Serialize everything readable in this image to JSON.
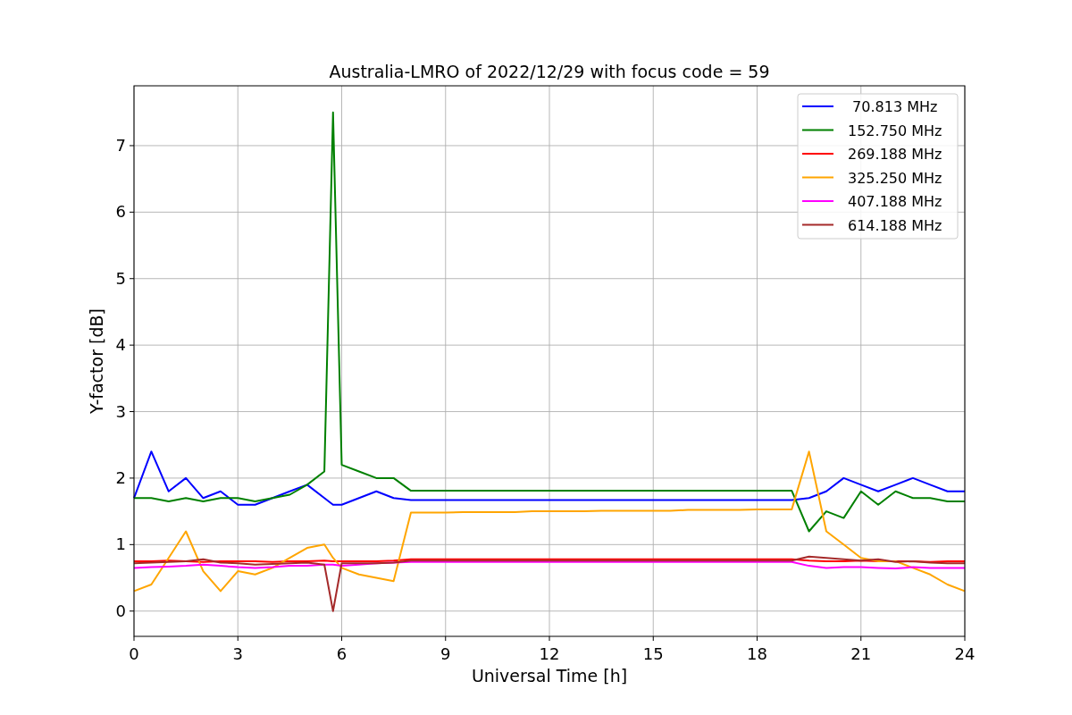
{
  "chart_data": {
    "type": "line",
    "title": "Australia-LMRO of 2022/12/29 with focus code = 59",
    "xlabel": "Universal Time [h]",
    "ylabel": "Y-factor [dB]",
    "x": [
      0,
      0.5,
      1,
      1.5,
      2,
      2.5,
      3,
      3.5,
      4,
      4.5,
      5,
      5.5,
      5.75,
      6,
      6.5,
      7,
      7.5,
      8,
      8.5,
      9,
      9.5,
      10,
      10.5,
      11,
      11.5,
      12,
      12.5,
      13,
      13.5,
      14,
      14.5,
      15,
      15.5,
      16,
      16.5,
      17,
      17.5,
      18,
      18.5,
      19,
      19.5,
      20,
      20.5,
      21,
      21.5,
      22,
      22.5,
      23,
      23.5,
      24
    ],
    "series": [
      {
        "name": " 70.813 MHz",
        "color": "#0000ff",
        "values": [
          1.7,
          2.4,
          1.8,
          2.0,
          1.7,
          1.8,
          1.6,
          1.6,
          1.7,
          1.8,
          1.9,
          1.7,
          1.6,
          1.6,
          1.7,
          1.8,
          1.7,
          1.67,
          1.67,
          1.67,
          1.67,
          1.67,
          1.67,
          1.67,
          1.67,
          1.67,
          1.67,
          1.67,
          1.67,
          1.67,
          1.67,
          1.67,
          1.67,
          1.67,
          1.67,
          1.67,
          1.67,
          1.67,
          1.67,
          1.67,
          1.7,
          1.8,
          2.0,
          1.9,
          1.8,
          1.9,
          2.0,
          1.9,
          1.8,
          1.8
        ]
      },
      {
        "name": "152.750 MHz",
        "color": "#008000",
        "values": [
          1.7,
          1.7,
          1.65,
          1.7,
          1.65,
          1.7,
          1.7,
          1.65,
          1.7,
          1.75,
          1.9,
          2.1,
          7.5,
          2.2,
          2.1,
          2.0,
          2.0,
          1.81,
          1.81,
          1.81,
          1.81,
          1.81,
          1.81,
          1.81,
          1.81,
          1.81,
          1.81,
          1.81,
          1.81,
          1.81,
          1.81,
          1.81,
          1.81,
          1.81,
          1.81,
          1.81,
          1.81,
          1.81,
          1.81,
          1.81,
          1.2,
          1.5,
          1.4,
          1.8,
          1.6,
          1.8,
          1.7,
          1.7,
          1.65,
          1.65
        ]
      },
      {
        "name": "269.188 MHz",
        "color": "#ff0000",
        "values": [
          0.75,
          0.75,
          0.76,
          0.75,
          0.74,
          0.75,
          0.75,
          0.75,
          0.74,
          0.75,
          0.75,
          0.76,
          0.75,
          0.75,
          0.75,
          0.75,
          0.76,
          0.78,
          0.78,
          0.78,
          0.78,
          0.78,
          0.78,
          0.78,
          0.78,
          0.78,
          0.78,
          0.78,
          0.78,
          0.78,
          0.78,
          0.78,
          0.78,
          0.78,
          0.78,
          0.78,
          0.78,
          0.78,
          0.78,
          0.78,
          0.76,
          0.75,
          0.75,
          0.76,
          0.75,
          0.75,
          0.75,
          0.74,
          0.75,
          0.75
        ]
      },
      {
        "name": "325.250 MHz",
        "color": "#ffa500",
        "values": [
          0.3,
          0.4,
          0.8,
          1.2,
          0.6,
          0.3,
          0.6,
          0.55,
          0.65,
          0.8,
          0.95,
          1.0,
          0.8,
          0.65,
          0.55,
          0.5,
          0.45,
          1.48,
          1.48,
          1.48,
          1.49,
          1.49,
          1.49,
          1.49,
          1.5,
          1.5,
          1.5,
          1.5,
          1.51,
          1.51,
          1.51,
          1.51,
          1.51,
          1.52,
          1.52,
          1.52,
          1.52,
          1.53,
          1.53,
          1.53,
          2.4,
          1.2,
          1.0,
          0.8,
          0.75,
          0.75,
          0.65,
          0.55,
          0.4,
          0.3
        ]
      },
      {
        "name": "407.188 MHz",
        "color": "#ff00ff",
        "values": [
          0.65,
          0.66,
          0.67,
          0.68,
          0.7,
          0.68,
          0.66,
          0.65,
          0.66,
          0.68,
          0.68,
          0.7,
          0.7,
          0.68,
          0.7,
          0.72,
          0.73,
          0.74,
          0.74,
          0.74,
          0.74,
          0.74,
          0.74,
          0.74,
          0.74,
          0.74,
          0.74,
          0.74,
          0.74,
          0.74,
          0.74,
          0.74,
          0.74,
          0.74,
          0.74,
          0.74,
          0.74,
          0.74,
          0.74,
          0.74,
          0.68,
          0.65,
          0.66,
          0.66,
          0.65,
          0.64,
          0.66,
          0.65,
          0.65,
          0.65
        ]
      },
      {
        "name": "614.188 MHz",
        "color": "#a52a2a",
        "values": [
          0.72,
          0.73,
          0.74,
          0.75,
          0.78,
          0.73,
          0.72,
          0.7,
          0.71,
          0.72,
          0.73,
          0.7,
          0.0,
          0.72,
          0.72,
          0.72,
          0.73,
          0.76,
          0.76,
          0.76,
          0.76,
          0.76,
          0.76,
          0.76,
          0.76,
          0.76,
          0.76,
          0.76,
          0.76,
          0.76,
          0.76,
          0.76,
          0.76,
          0.76,
          0.76,
          0.76,
          0.76,
          0.76,
          0.76,
          0.76,
          0.82,
          0.8,
          0.78,
          0.76,
          0.78,
          0.74,
          0.75,
          0.73,
          0.72,
          0.72
        ]
      }
    ],
    "grid": true,
    "legend": true,
    "xlim": [
      0,
      24
    ],
    "ylim": [
      -0.38,
      7.9
    ],
    "xticks": [
      0,
      3,
      6,
      9,
      12,
      15,
      18,
      21,
      24
    ],
    "yticks": [
      0,
      1,
      2,
      3,
      4,
      5,
      6,
      7
    ]
  }
}
